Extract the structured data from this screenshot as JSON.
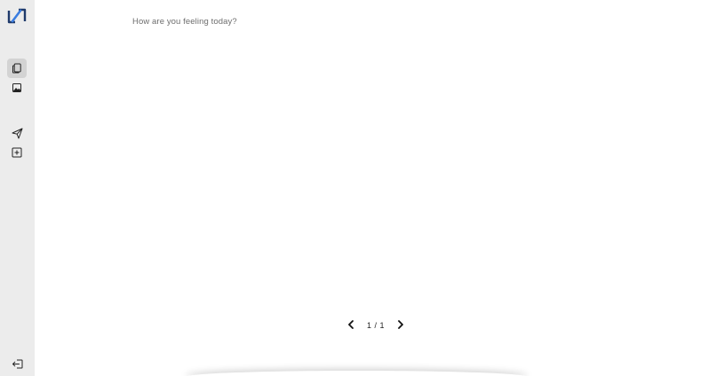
{
  "app": {
    "logo_icon": "app-logo-icon",
    "brand_color": "#1f3a6b"
  },
  "sidebar": {
    "items": [
      {
        "icon": "copy-icon",
        "active": true
      },
      {
        "icon": "image-icon",
        "active": false
      },
      {
        "icon": "send-icon",
        "active": false
      },
      {
        "icon": "plus-square-icon",
        "active": false
      }
    ],
    "logout_icon": "logout-icon"
  },
  "main": {
    "prompt": "How are you feeling today?"
  },
  "pager": {
    "prev_icon": "chevron-left-icon",
    "next_icon": "chevron-right-icon",
    "count": "1 / 1"
  },
  "colors": {
    "sidebar_bg": "#ececec",
    "active_bg": "#d3d3d3",
    "text_muted": "#6e6e6e"
  }
}
